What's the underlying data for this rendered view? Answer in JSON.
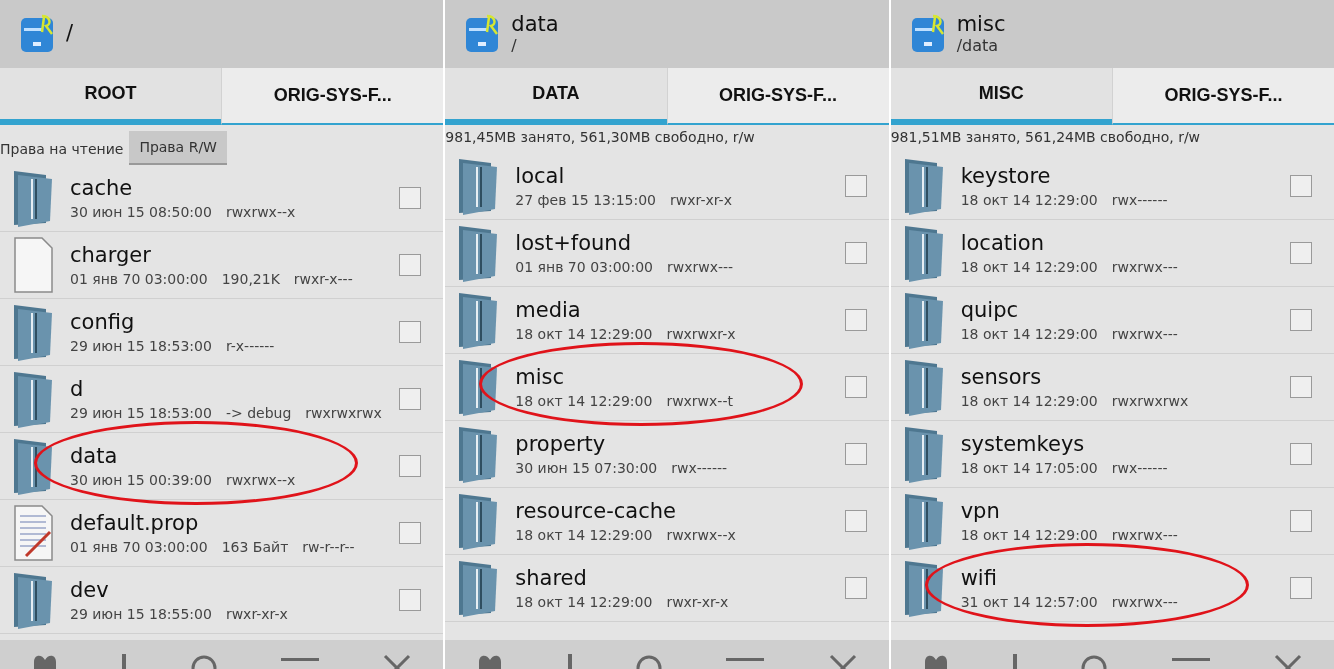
{
  "panels": [
    {
      "title": "/",
      "tabs": [
        {
          "label": "ROOT",
          "selected": true
        },
        {
          "label": "ORIG-SYS-F...",
          "selected": false
        }
      ],
      "buttons": [
        {
          "label": "Права на чтение",
          "selected": false
        },
        {
          "label": "Права R/W",
          "selected": true
        }
      ],
      "rows": [
        {
          "kind": "folder",
          "name": "cache",
          "date": "30 июн 15 08:50:00",
          "perms": "rwxrwx--x",
          "checked": false,
          "circled": false
        },
        {
          "kind": "file",
          "name": "charger",
          "date": "01 янв 70 03:00:00",
          "extra": "190,21K",
          "perms": "rwxr-x---",
          "checked": false,
          "circled": false
        },
        {
          "kind": "folder",
          "name": "config",
          "date": "29 июн 15 18:53:00",
          "perms": "r-x------",
          "checked": false,
          "circled": false
        },
        {
          "kind": "folder",
          "name": "d",
          "date": "29 июн 15 18:53:00",
          "extra": "-> debug",
          "perms": "rwxrwxrwx",
          "checked": false,
          "circled": false
        },
        {
          "kind": "folder",
          "name": "data",
          "date": "30 июн 15 00:39:00",
          "perms": "rwxrwx--x",
          "checked": false,
          "circled": true
        },
        {
          "kind": "text-file",
          "name": "default.prop",
          "date": "01 янв 70 03:00:00",
          "extra": "163 Байт",
          "perms": "rw-r--r--",
          "checked": false,
          "circled": false
        },
        {
          "kind": "folder",
          "name": "dev",
          "date": "29 июн 15 18:55:00",
          "perms": "rwxr-xr-x",
          "checked": false,
          "circled": false
        }
      ]
    },
    {
      "title": "data",
      "path": "/",
      "tabs": [
        {
          "label": "DATA",
          "selected": true
        },
        {
          "label": "ORIG-SYS-F...",
          "selected": false
        }
      ],
      "status": "981,45MB занято, 561,30MB свободно, r/w",
      "rows": [
        {
          "kind": "folder",
          "name": "local",
          "date": "27 фев 15 13:15:00",
          "perms": "rwxr-xr-x",
          "checked": false,
          "circled": false
        },
        {
          "kind": "folder",
          "name": "lost+found",
          "date": "01 янв 70 03:00:00",
          "perms": "rwxrwx---",
          "checked": false,
          "circled": false
        },
        {
          "kind": "folder",
          "name": "media",
          "date": "18 окт 14 12:29:00",
          "perms": "rwxrwxr-x",
          "checked": false,
          "circled": false
        },
        {
          "kind": "folder",
          "name": "misc",
          "date": "18 окт 14 12:29:00",
          "perms": "rwxrwx--t",
          "checked": false,
          "circled": true
        },
        {
          "kind": "folder",
          "name": "property",
          "date": "30 июн 15 07:30:00",
          "perms": "rwx------",
          "checked": false,
          "circled": false
        },
        {
          "kind": "folder",
          "name": "resource-cache",
          "date": "18 окт 14 12:29:00",
          "perms": "rwxrwx--x",
          "checked": false,
          "circled": false
        },
        {
          "kind": "folder",
          "name": "shared",
          "date": "18 окт 14 12:29:00",
          "perms": "rwxr-xr-x",
          "checked": false,
          "circled": false
        }
      ]
    },
    {
      "title": "misc",
      "path": "/data",
      "tabs": [
        {
          "label": "MISC",
          "selected": true
        },
        {
          "label": "ORIG-SYS-F...",
          "selected": false
        }
      ],
      "status": "981,51MB занято, 561,24MB свободно, r/w",
      "rows": [
        {
          "kind": "folder",
          "name": "keystore",
          "date": "18 окт 14 12:29:00",
          "perms": "rwx------",
          "checked": false,
          "circled": false
        },
        {
          "kind": "folder",
          "name": "location",
          "date": "18 окт 14 12:29:00",
          "perms": "rwxrwx---",
          "checked": false,
          "circled": false
        },
        {
          "kind": "folder",
          "name": "quipc",
          "date": "18 окт 14 12:29:00",
          "perms": "rwxrwx---",
          "checked": false,
          "circled": false
        },
        {
          "kind": "folder",
          "name": "sensors",
          "date": "18 окт 14 12:29:00",
          "perms": "rwxrwxrwx",
          "checked": false,
          "circled": false
        },
        {
          "kind": "folder",
          "name": "systemkeys",
          "date": "18 окт 14 17:05:00",
          "perms": "rwx------",
          "checked": false,
          "circled": false
        },
        {
          "kind": "folder",
          "name": "vpn",
          "date": "18 окт 14 12:29:00",
          "perms": "rwxrwx---",
          "checked": false,
          "circled": false
        },
        {
          "kind": "folder",
          "name": "wifi",
          "date": "31 окт 14 12:57:00",
          "perms": "rwxrwx---",
          "checked": false,
          "circled": true
        }
      ]
    }
  ]
}
